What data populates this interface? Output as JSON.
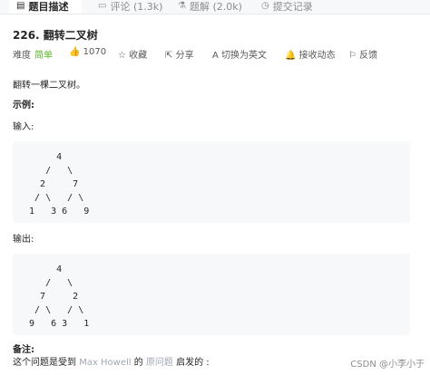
{
  "tabs": [
    {
      "label": "题目描述",
      "icon": "file-text-icon"
    },
    {
      "label": "评论 (1.3k)",
      "icon": "comment-icon"
    },
    {
      "label": "题解 (2.0k)",
      "icon": "flask-icon"
    },
    {
      "label": "提交记录",
      "icon": "history-icon"
    }
  ],
  "problem": {
    "title": "226. 翻转二叉树",
    "difficulty_label": "难度",
    "difficulty": "简单",
    "likes": "1070",
    "actions": [
      {
        "label": "收藏",
        "icon": "star-icon"
      },
      {
        "label": "分享",
        "icon": "share-icon"
      },
      {
        "label": "切换为英文",
        "icon": "translate-icon"
      },
      {
        "label": "接收动态",
        "icon": "bell-icon"
      },
      {
        "label": "反馈",
        "icon": "feedback-icon"
      }
    ]
  },
  "description": {
    "intro": "翻转一棵二叉树。",
    "example_heading": "示例:",
    "input_label": "输入:",
    "input_tree": "      4\n    /   \\\n   2     7\n  / \\   / \\\n 1   3 6   9",
    "output_label": "输出:",
    "output_tree": "      4\n    /   \\\n   7     2\n  / \\   / \\\n 9   6 3   1",
    "note_heading": "备注:",
    "note_prefix": "这个问题是受到 ",
    "note_link1": "Max Howell",
    "note_mid1": " 的 ",
    "note_link2": "原问题",
    "note_suffix": " 启发的 :"
  },
  "watermark": "CSDN @小李小于"
}
